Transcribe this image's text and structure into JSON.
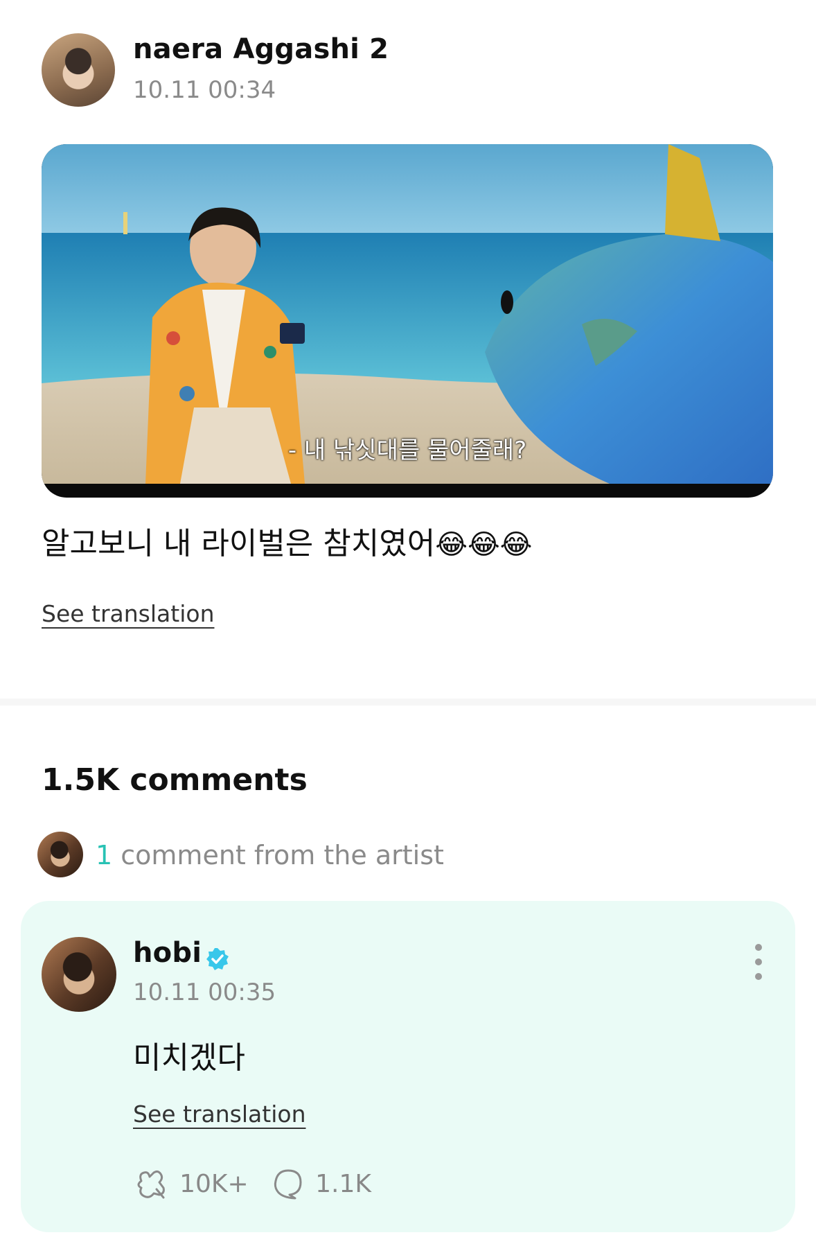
{
  "post": {
    "author_name": "naera Aggashi 2",
    "timestamp": "10.11 00:34",
    "image_subtitle": "- 내 낚싯대를 물어줄래?",
    "text": "알고보니 내 라이벌은 참치였어",
    "emojis": "😂😂😂",
    "see_translation": "See translation"
  },
  "comments": {
    "heading": "1.5K comments",
    "artist_count": "1",
    "artist_label": " comment from the artist",
    "items": [
      {
        "author_name": "hobi",
        "verified_icon": "verified-badge-icon",
        "timestamp": "10.11 00:35",
        "text": "미치겠다",
        "see_translation": "See translation",
        "likes": "10K+",
        "replies": "1.1K"
      }
    ]
  },
  "colors": {
    "accent": "#28c2b4",
    "comment_card_bg": "#eafbf6",
    "muted_text": "#8a8a8a"
  }
}
